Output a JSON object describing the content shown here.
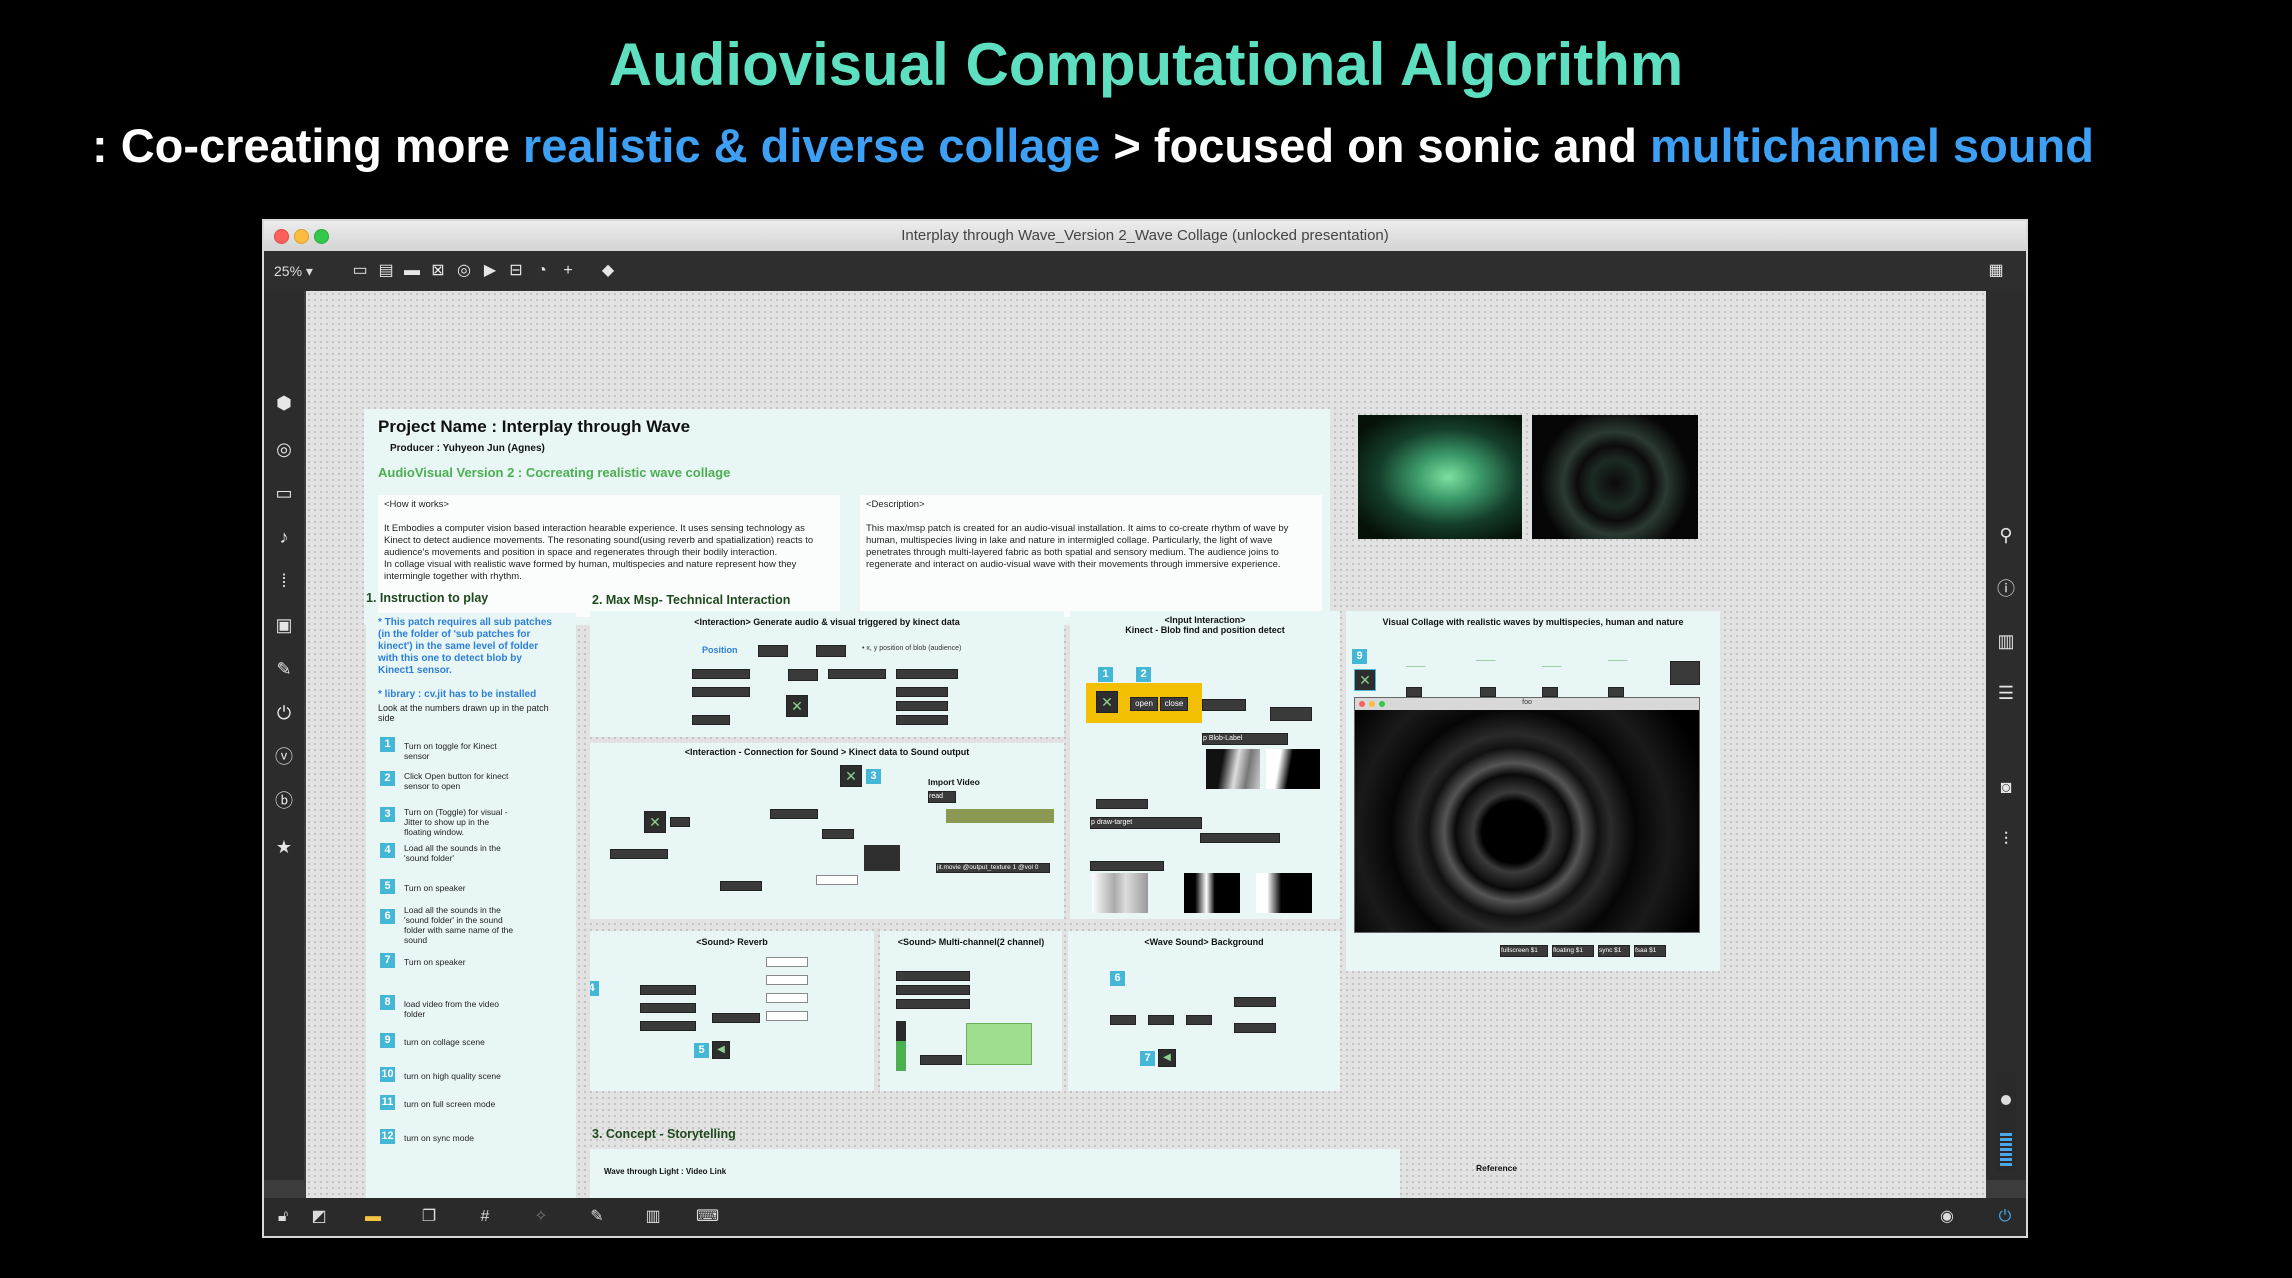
{
  "slide": {
    "title": "Audiovisual Computational Algorithm",
    "subtitle_1": ": Co-creating more ",
    "subtitle_hl1": "realistic & diverse collage",
    "subtitle_2": "  > focused on sonic and ",
    "subtitle_hl2": "multichannel sound"
  },
  "window": {
    "title": "Interplay through Wave_Version 2_Wave Collage (unlocked presentation)",
    "zoom": "25% ▾"
  },
  "project": {
    "name": "Project Name  :  Interplay through Wave",
    "producer": "Producer : Yuhyeon Jun (Agnes)",
    "version": "AudioVisual Version 2 : Cocreating realistic wave collage",
    "how_title": "<How it works>",
    "how_text": "It Embodies a computer vision based interaction hearable experience. It uses sensing technology as Kinect to detect audience movements. The resonating sound(using reverb and spatialization) reacts to audience's movements and position in space and regenerates through their bodily interaction.\nIn collage visual with realistic wave formed by human, multispecies and nature represent how they intermingle together with rhythm.",
    "desc_title": "<Description>",
    "desc_text": "This max/msp patch is created for an audio-visual installation. It aims to co-create rhythm of wave by human, multispecies living in lake and nature in intermigled collage. Particularly, the light of wave penetrates through multi-layered fabric as both spatial and sensory medium. The audience joins to regenerate and interact on audio-visual wave with their movements through immersive experience."
  },
  "instruction": {
    "heading": "1. Instruction to play",
    "note": "* This patch requires all sub patches (in the folder of 'sub patches for kinect') in the same level of folder with this one to detect blob by Kinect1 sensor.",
    "library": "* library : cv.jit has to be installed",
    "look": "Look at the numbers drawn up in the patch side",
    "steps": [
      {
        "n": "1",
        "text": "Turn on toggle for Kinect sensor"
      },
      {
        "n": "2",
        "text": "Click Open button for kinect sensor to open"
      },
      {
        "n": "3",
        "text": "Turn on (Toggle) for visual - Jitter to show up in the floating window."
      },
      {
        "n": "4",
        "text": "Load all the sounds in the 'sound folder'"
      },
      {
        "n": "5",
        "text": "Turn on speaker"
      },
      {
        "n": "6",
        "text": "Load all the sounds in the 'sound folder' in the sound folder with same name of the sound"
      },
      {
        "n": "7",
        "text": "Turn on speaker"
      },
      {
        "n": "8",
        "text": "load video from the video folder"
      },
      {
        "n": "9",
        "text": "turn on collage scene"
      },
      {
        "n": "10",
        "text": "turn on high quality scene"
      },
      {
        "n": "11",
        "text": "turn on full screen mode"
      },
      {
        "n": "12",
        "text": "turn on sync mode"
      }
    ]
  },
  "maxmsp": {
    "heading": "2. Max Msp- Technical Interaction",
    "p_interaction": "<Interaction>  Generate audio & visual triggered by kinect data",
    "position": "Position",
    "xy_note": "• x, y position of blob (audience)",
    "p_connection": "<Interaction - Connection for Sound >  Kinect data to Sound output",
    "import_video": "Import Video",
    "read": "read",
    "jit_movie": "jit.movie @output_texture 1 @vol 0",
    "p_input": "<Input Interaction>\nKinect - Blob find and position detect",
    "open": "open",
    "close": "close",
    "blob_label": "p Blob-Label",
    "draw_target": "p draw-target",
    "p_reverb": "<Sound> Reverb",
    "p_multichannel": "<Sound> Multi-channel(2 channel)",
    "p_background": "<Wave Sound> Background",
    "p_visual": "Visual Collage with realistic waves by multispecies, human and nature",
    "float_title": "foo",
    "btn_fullscreen": "fullscreen $1",
    "btn_floating": "floating $1",
    "btn_sync": "sync $1",
    "btn_fsaa": "fsaa $1"
  },
  "concept": {
    "heading": "3. Concept - Storytelling",
    "sub": "Wave through Light : Video Link",
    "reference": "Reference"
  },
  "icons": {
    "left": [
      "package-icon",
      "target-icon",
      "dialog-icon",
      "music-note-icon",
      "dotted-list-icon",
      "image-icon",
      "paperclip-icon",
      "plug-icon",
      "v-circle-icon",
      "b-circle-icon",
      "star-icon"
    ],
    "right": [
      "search-icon",
      "info-icon",
      "book-icon",
      "list-icon",
      "camera-icon",
      "mixer-icon"
    ]
  },
  "colors": {
    "title_teal": "#5ee0c0",
    "highlight_blue": "#3ea0f4",
    "section_green": "#4caf50",
    "step_badge": "#44b6d6"
  }
}
